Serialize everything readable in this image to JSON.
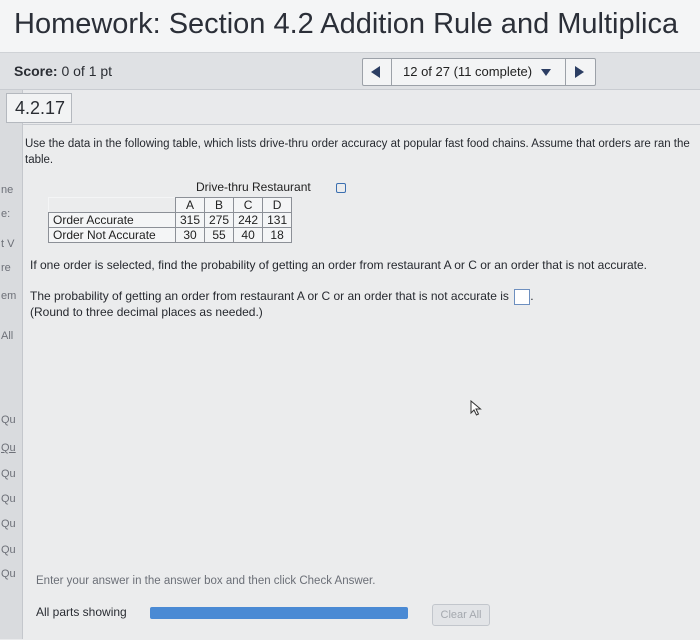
{
  "header": {
    "title": "Homework: Section 4.2 Addition Rule and Multiplica"
  },
  "score_bar": {
    "score_label": "Score:",
    "score_value": "0 of 1 pt",
    "nav_label": "12 of 27 (11 complete)"
  },
  "sidebar": {
    "fragments": [
      "ne",
      "e:",
      "t V",
      "re",
      "em",
      "All",
      "Qu",
      "Qu",
      "Qu",
      "Qu",
      "Qu",
      "Qu",
      "Qu"
    ]
  },
  "problem": {
    "number": "4.2.17",
    "instructions": "Use the data in the following table, which lists drive-thru order accuracy at popular fast food chains. Assume that orders are ran the table.",
    "table_title": "Drive-thru Restaurant",
    "table": {
      "columns": [
        "A",
        "B",
        "C",
        "D"
      ],
      "rows": [
        {
          "label": "Order Accurate",
          "values": [
            "315",
            "275",
            "242",
            "131"
          ]
        },
        {
          "label": "Order Not Accurate",
          "values": [
            "30",
            "55",
            "40",
            "18"
          ]
        }
      ]
    },
    "question": "If one order is selected, find the probability of getting an order from restaurant A or C or an order that is not accurate.",
    "answer_prompt": "The probability of getting an order from restaurant A or C or an order that is not accurate is",
    "answer_value": "",
    "round_note": "(Round to three decimal places as needed.)"
  },
  "footer": {
    "hint": "Enter your answer in the answer box and then click Check Answer.",
    "parts_label": "All parts showing",
    "progress_fraction": 1.0,
    "clear_all_label": "Clear All"
  },
  "colors": {
    "accent": "#4a8ad4",
    "nav_arrow": "#2c3e63"
  }
}
